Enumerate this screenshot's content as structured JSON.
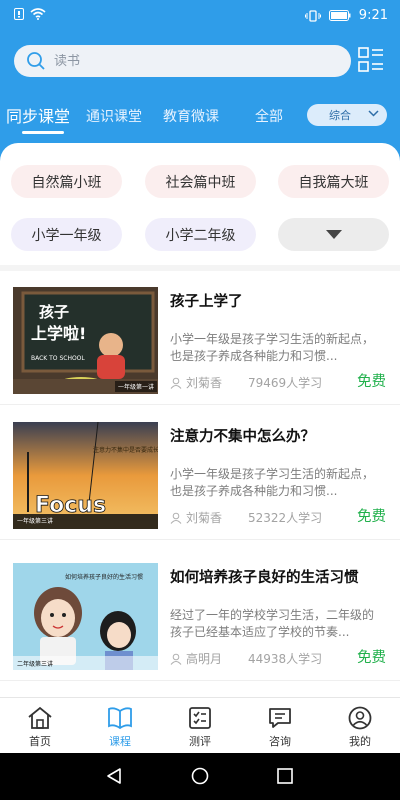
{
  "status": {
    "time": "9:21"
  },
  "search": {
    "placeholder": "读书"
  },
  "tabs": [
    {
      "label": "同步课堂",
      "active": true
    },
    {
      "label": "通识课堂"
    },
    {
      "label": "教育微课"
    },
    {
      "label": "全部"
    }
  ],
  "sort": {
    "label": "综合"
  },
  "filters": {
    "row1": [
      "自然篇小班",
      "社会篇中班",
      "自我篇大班"
    ],
    "row2": [
      "小学一年级",
      "小学二年级"
    ]
  },
  "courses": [
    {
      "title": "孩子上学了",
      "desc": "小学一年级是孩子学习生活的新起点，也是孩子养成各种能力和习惯...",
      "teacher": "刘菊香",
      "learners": "79469人学习",
      "price": "免费",
      "thumb": {
        "line1": "孩子",
        "line2": "上学啦!",
        "sub": "BACK TO SCHOOL",
        "tag": "一年级第一讲"
      }
    },
    {
      "title": "注意力不集中怎么办？",
      "desc": "小学一年级是孩子学习生活的新起点，也是孩子养成各种能力和习惯...",
      "teacher": "刘菊香",
      "learners": "52322人学习",
      "price": "免费",
      "thumb": {
        "big": "Focus",
        "question": "注意力不集中是否要成长?",
        "tag": "一年级第三讲"
      }
    },
    {
      "title": "如何培养孩子良好的生活习惯",
      "desc": "经过了一年的学校学习生活，二年级的孩子已经基本适应了学校的节奏...",
      "teacher": "高明月",
      "learners": "44938人学习",
      "price": "免费",
      "thumb": {
        "heading": "如何培养孩子良好的生活习惯",
        "tag": "二年级第三讲"
      }
    }
  ],
  "nav": [
    {
      "label": "首页",
      "icon": "home-icon"
    },
    {
      "label": "课程",
      "icon": "book-icon",
      "active": true
    },
    {
      "label": "测评",
      "icon": "checklist-icon"
    },
    {
      "label": "咨询",
      "icon": "chat-icon"
    },
    {
      "label": "我的",
      "icon": "user-icon"
    }
  ],
  "colors": {
    "primary": "#2f9de9",
    "free": "#20b04b"
  }
}
